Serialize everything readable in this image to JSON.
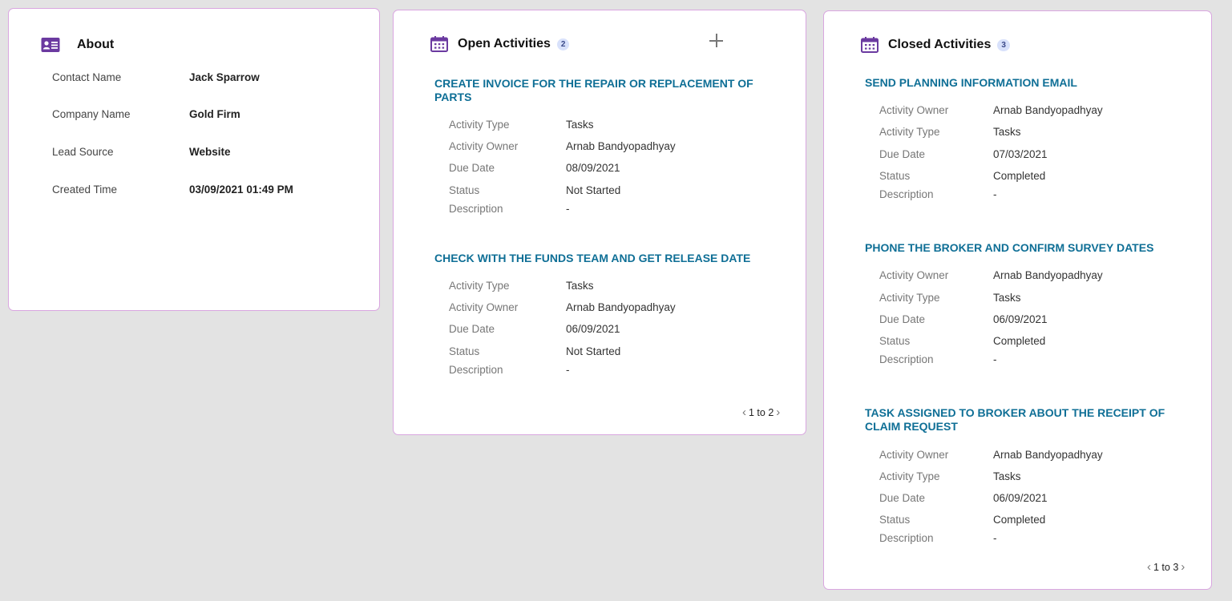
{
  "about": {
    "title": "About",
    "icon": "contact-card-icon",
    "rows": [
      {
        "label": "Contact Name",
        "value": "Jack Sparrow"
      },
      {
        "label": "Company Name",
        "value": "Gold Firm"
      },
      {
        "label": "Lead Source",
        "value": "Website"
      },
      {
        "label": "Created Time",
        "value": "03/09/2021 01:49 PM"
      }
    ]
  },
  "open_activities": {
    "title": "Open Activities",
    "count": "2",
    "icon": "calendar-icon",
    "add_icon": "plus-icon",
    "items": [
      {
        "title": "CREATE INVOICE FOR THE REPAIR OR REPLACEMENT OF PARTS",
        "fields": [
          {
            "label": "Activity Type",
            "value": "Tasks"
          },
          {
            "label": "Activity Owner",
            "value": "Arnab Bandyopadhyay"
          },
          {
            "label": "Due Date",
            "value": "08/09/2021"
          },
          {
            "label": "Status",
            "value": "Not Started"
          },
          {
            "label": "Description",
            "value": "-"
          }
        ]
      },
      {
        "title": "CHECK WITH THE FUNDS TEAM AND GET RELEASE DATE",
        "fields": [
          {
            "label": "Activity Type",
            "value": "Tasks"
          },
          {
            "label": "Activity Owner",
            "value": "Arnab Bandyopadhyay"
          },
          {
            "label": "Due Date",
            "value": "06/09/2021"
          },
          {
            "label": "Status",
            "value": "Not Started"
          },
          {
            "label": "Description",
            "value": "-"
          }
        ]
      }
    ],
    "pager": "1 to 2"
  },
  "closed_activities": {
    "title": "Closed Activities",
    "count": "3",
    "icon": "calendar-icon",
    "items": [
      {
        "title": "SEND PLANNING INFORMATION EMAIL",
        "fields": [
          {
            "label": "Activity Owner",
            "value": "Arnab Bandyopadhyay"
          },
          {
            "label": "Activity Type",
            "value": "Tasks"
          },
          {
            "label": "Due Date",
            "value": "07/03/2021"
          },
          {
            "label": "Status",
            "value": "Completed"
          },
          {
            "label": "Description",
            "value": "-"
          }
        ]
      },
      {
        "title": "PHONE THE BROKER AND CONFIRM SURVEY DATES",
        "fields": [
          {
            "label": "Activity Owner",
            "value": "Arnab Bandyopadhyay"
          },
          {
            "label": "Activity Type",
            "value": "Tasks"
          },
          {
            "label": "Due Date",
            "value": "06/09/2021"
          },
          {
            "label": "Status",
            "value": "Completed"
          },
          {
            "label": "Description",
            "value": "-"
          }
        ]
      },
      {
        "title": "TASK ASSIGNED TO BROKER ABOUT THE RECEIPT OF CLAIM REQUEST",
        "fields": [
          {
            "label": "Activity Owner",
            "value": "Arnab Bandyopadhyay"
          },
          {
            "label": "Activity Type",
            "value": "Tasks"
          },
          {
            "label": "Due Date",
            "value": "06/09/2021"
          },
          {
            "label": "Status",
            "value": "Completed"
          },
          {
            "label": "Description",
            "value": "-"
          }
        ]
      }
    ],
    "pager": "1 to 3"
  },
  "colors": {
    "accent_purple": "#6b3aa0",
    "title_teal": "#0f6f96",
    "card_border": "#d9a6e0",
    "badge_bg": "#d8e1fb",
    "page_bg": "#e3e3e3"
  }
}
